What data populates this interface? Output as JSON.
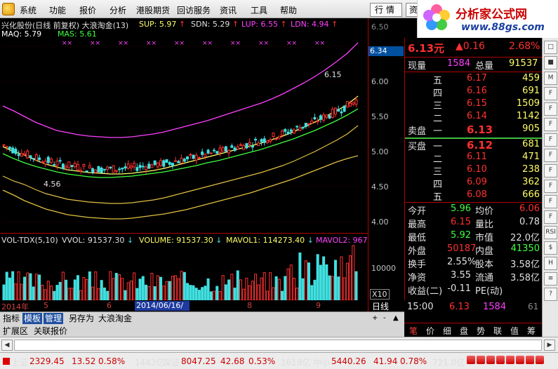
{
  "menu": {
    "items": [
      "系统",
      "功能",
      "报价",
      "分析",
      "港股期货",
      "回访服务",
      "资讯",
      "工具",
      "帮助"
    ],
    "quote_tab": "行情",
    "info_tab": "资讯"
  },
  "brand": {
    "title": "分析家公式网",
    "url": "www.88gs.com"
  },
  "chart": {
    "title_line": "兴化股份(日线 前复权) 大浪淘金(13)",
    "sup": "SUP: 5.97",
    "sdn": "SDN: 5.29",
    "lup": "LUP: 6.55",
    "ldn": "LDN: 4.94",
    "maq": "MAQ: 5.79",
    "mas": "MAS: 5.61",
    "high_label": "6.15",
    "low_label": "4.56",
    "axis_prices": [
      "6.50",
      "6.00",
      "5.50",
      "5.00",
      "4.50",
      "4.00"
    ],
    "last_price_tag": "6.34",
    "vol_title": "VOL-TDX(5,10)",
    "vvol": "VVOL: 91537.30",
    "volume": "VOLUME: 91537.30",
    "mavol1": "MAVOL1: 114273.40",
    "mavol2": "MAVOL2: 967",
    "vol_axis": "10000",
    "vol_unit": "X10",
    "timeline": [
      "2014年",
      "5",
      "6",
      "7",
      "8",
      "9"
    ],
    "date_marker": "2014/06/16/—",
    "period": "日线",
    "colors": {
      "up": "#ff3030",
      "down": "#40e0e0",
      "sup": "#ffff66",
      "lup": "#ff40ff",
      "maq": "#ffffff",
      "mas": "#40ff40",
      "ldn": "#e0c040"
    }
  },
  "chart_data": {
    "type": "candlestick",
    "series": [
      {
        "name": "MAQ",
        "values": [
          5.07,
          5.0,
          4.95,
          4.88,
          4.82,
          4.78,
          4.74,
          4.72,
          4.7,
          4.69,
          4.68,
          4.68,
          4.69,
          4.71,
          4.73,
          4.76,
          4.8,
          4.84,
          4.88,
          4.92,
          4.96,
          5.0,
          5.04,
          5.08,
          5.12,
          5.17,
          5.22,
          5.28,
          5.35,
          5.42,
          5.5,
          5.58,
          5.67,
          5.79
        ]
      },
      {
        "name": "MAS",
        "values": [
          4.97,
          4.9,
          4.84,
          4.79,
          4.75,
          4.71,
          4.68,
          4.66,
          4.64,
          4.63,
          4.63,
          4.64,
          4.65,
          4.67,
          4.69,
          4.71,
          4.74,
          4.77,
          4.8,
          4.84,
          4.87,
          4.91,
          4.95,
          4.99,
          5.03,
          5.08,
          5.13,
          5.18,
          5.24,
          5.3,
          5.37,
          5.44,
          5.52,
          5.61
        ]
      },
      {
        "name": "LUP",
        "values": [
          5.65,
          5.58,
          5.5,
          5.42,
          5.36,
          5.3,
          5.27,
          5.24,
          5.22,
          5.21,
          5.2,
          5.2,
          5.21,
          5.23,
          5.25,
          5.28,
          5.32,
          5.36,
          5.4,
          5.44,
          5.49,
          5.54,
          5.59,
          5.64,
          5.69,
          5.75,
          5.82,
          5.9,
          5.98,
          6.07,
          6.17,
          6.28,
          6.4,
          6.55
        ]
      },
      {
        "name": "LDN",
        "values": [
          4.45,
          4.38,
          4.3,
          4.24,
          4.18,
          4.14,
          4.1,
          4.08,
          4.06,
          4.05,
          4.04,
          4.04,
          4.05,
          4.07,
          4.09,
          4.11,
          4.14,
          4.17,
          4.21,
          4.25,
          4.29,
          4.33,
          4.37,
          4.41,
          4.46,
          4.51,
          4.56,
          4.61,
          4.67,
          4.73,
          4.79,
          4.85,
          4.9,
          4.94
        ]
      }
    ],
    "high": 6.15,
    "low": 4.56,
    "ylim": [
      3.9,
      6.6
    ]
  },
  "quote": {
    "price": "6.13元",
    "change": "▲0.16",
    "pct": "2.68%",
    "xianliang_label": "现量",
    "xianliang": "1584",
    "zongliang_label": "总量",
    "zongliang": "91537",
    "sell_label": "卖盘",
    "buy_label": "买盘",
    "sells": [
      {
        "label": "五",
        "price": "6.17",
        "vol": "459"
      },
      {
        "label": "四",
        "price": "6.16",
        "vol": "691"
      },
      {
        "label": "三",
        "price": "6.15",
        "vol": "1509"
      },
      {
        "label": "二",
        "price": "6.14",
        "vol": "1142"
      },
      {
        "label": "一",
        "price": "6.13",
        "vol": "905"
      }
    ],
    "buys": [
      {
        "label": "一",
        "price": "6.12",
        "vol": "681"
      },
      {
        "label": "二",
        "price": "6.11",
        "vol": "471"
      },
      {
        "label": "三",
        "price": "6.10",
        "vol": "238"
      },
      {
        "label": "四",
        "price": "6.09",
        "vol": "362"
      },
      {
        "label": "五",
        "price": "6.08",
        "vol": "666"
      }
    ],
    "stats": [
      {
        "l1": "今开",
        "v1": "5.96",
        "l2": "均价",
        "v2": "6.06"
      },
      {
        "l1": "最高",
        "v1": "6.15",
        "l2": "量比",
        "v2": "0.78"
      },
      {
        "l1": "最低",
        "v1": "5.92",
        "l2": "市值",
        "v2": "22.0亿"
      },
      {
        "l1": "外盘",
        "v1": "50187",
        "l2": "内盘",
        "v2": "41350"
      },
      {
        "l1": "换手",
        "v1": "2.55%",
        "l2": "股本",
        "v2": "3.58亿"
      },
      {
        "l1": "净资",
        "v1": "3.55",
        "l2": "流通",
        "v2": "3.58亿"
      },
      {
        "l1": "收益(二)",
        "v1": "-0.11",
        "l2": "PE(动)",
        "v2": ""
      }
    ],
    "time": "15:00",
    "time_price": "6.13",
    "time_vol": "1584",
    "time_n": "61"
  },
  "bottom_tabs": [
    "指标",
    "模板",
    "管理",
    "另存为",
    "大浪淘金"
  ],
  "bottom_tabs2": [
    "扩展区",
    "关联报价"
  ],
  "right_buttons": [
    "笔",
    "价",
    "细",
    "盘",
    "势",
    "联",
    "值",
    "筹"
  ],
  "tools": [
    "□",
    "■",
    "M",
    "F",
    "F",
    "F",
    "F",
    "F",
    "F",
    "F",
    "F",
    "F",
    "RSI",
    "$",
    "H",
    "≡",
    "?"
  ],
  "status": {
    "sh_label": "上证",
    "sh_val": "2329.45",
    "sh_chg": "13.52",
    "sh_pct": "0.58%",
    "sh_amt": "1443亿",
    "sz_label": "深证",
    "sz_val": "8047.25",
    "sz_chg": "42.68",
    "sz_pct": "0.53%",
    "sz_amt": "1618亿",
    "zx_label": "中小",
    "zx_val": "5440.26",
    "zx_chg": "41.94",
    "zx_pct": "0.78%",
    "zx_amt": "721.0亿"
  }
}
